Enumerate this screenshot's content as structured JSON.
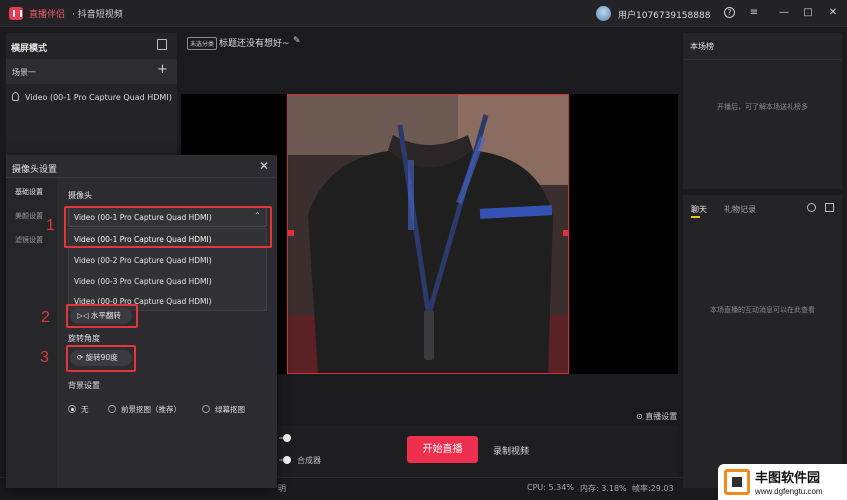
{
  "titlebar": {
    "app_name": "直播伴侣",
    "app_subtitle": "· 抖音短视频",
    "username": "用户1076739158888",
    "help_glyph": "?",
    "menu_glyph": "≡",
    "minimize_glyph": "—",
    "maximize_glyph": "□",
    "close_glyph": "✕"
  },
  "left_panel": {
    "mode_title": "横屏模式",
    "scene_label": "场景一",
    "add_glyph": "+",
    "source_name": "Video (00-1 Pro Capture Quad HDMI)"
  },
  "stream_header": {
    "category_tag": "未选分类",
    "title": "标题还没有想好~",
    "edit_glyph": "✎"
  },
  "camera_dialog": {
    "title": "摄像头设置",
    "close_glyph": "✕",
    "nav": [
      "基础设置",
      "美颜设置",
      "滤镜设置"
    ],
    "camera_section_label": "摄像头",
    "selected_camera": "Video (00-1 Pro Capture Quad HDMI)",
    "caret_glyph": "⌃",
    "camera_options": [
      "Video (00-1 Pro Capture Quad HDMI)",
      "Video (00-2 Pro Capture Quad HDMI)",
      "Video (00-3 Pro Capture Quad HDMI)",
      "Video (00-0 Pro Capture Quad HDMI)"
    ],
    "flip_button": "▷◁ 水平翻转",
    "rotation_label": "旋转角度",
    "rotate_button": "⟳ 旋转90度",
    "background_label": "背景设置",
    "background_options": [
      "无",
      "前景抠图（推荐）",
      "绿幕抠图"
    ],
    "annotations": [
      "1",
      "2",
      "3"
    ]
  },
  "controls": {
    "live_settings": "⊙ 直播设置",
    "mixer_label": "合成器",
    "start_live": "开始直播",
    "record_video": "录制视频"
  },
  "statusbar": {
    "left_text": "明",
    "cpu": "CPU: 5.34%",
    "memory": "内存: 3.18%",
    "fps": "帧率:29.03"
  },
  "right_panel": {
    "rank_title": "本场榜",
    "rank_empty": "开播后，可了解本场送礼榜多",
    "chat_tab": "聊天",
    "gift_tab": "礼物记录",
    "chat_empty": "本场直播的互动消息可以在此查看"
  },
  "watermark": {
    "name": "丰图软件园",
    "url": "www.dgfengtu.com"
  },
  "colors": {
    "accent_red": "#ee2f4d",
    "annotation_red": "#e2373a",
    "panel_bg": "#242428",
    "tab_underline": "#e9c234"
  }
}
